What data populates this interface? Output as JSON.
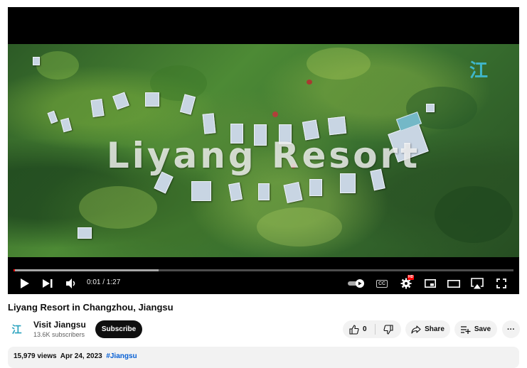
{
  "video": {
    "overlay_title": "Liyang Resort",
    "watermark": "江",
    "title": "Liyang Resort in Changzhou, Jiangsu"
  },
  "player": {
    "current_time": "0:01",
    "duration": "1:27",
    "time_display": "0:01 / 1:27",
    "played_fraction": 0.003,
    "buffered_fraction": 0.29,
    "quality_badge": "HD",
    "cc_label": "CC"
  },
  "channel": {
    "name": "Visit Jiangsu",
    "subscribers": "13.6K subscribers",
    "avatar_glyph": "江",
    "subscribe_label": "Subscribe"
  },
  "actions": {
    "like_count": "0",
    "share_label": "Share",
    "save_label": "Save",
    "more_label": "···"
  },
  "description": {
    "views": "15,979 views",
    "date": "Apr 24, 2023",
    "hashtag": "#Jiangsu"
  },
  "colors": {
    "progress_played": "#ff0000",
    "hashtag_link": "#065fd4",
    "subscribe_bg": "#0f0f0f"
  }
}
